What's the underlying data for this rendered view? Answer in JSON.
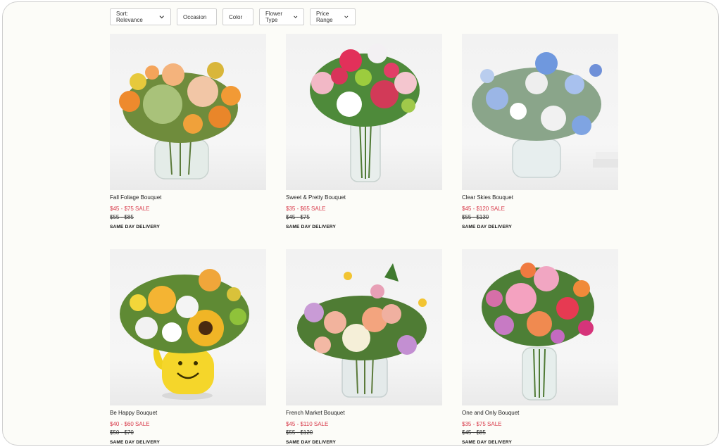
{
  "filters": {
    "sort": "Sort: Relevance",
    "occasion": "Occasion",
    "color": "Color",
    "flower_type": "Flower Type",
    "price_range": "Price Range"
  },
  "products": [
    {
      "name": "Fall Foliage Bouquet",
      "price": "$45 - $75 SALE",
      "original": "$55 - $85",
      "delivery": "SAME DAY DELIVERY"
    },
    {
      "name": "Sweet & Pretty Bouquet",
      "price": "$35 - $65 SALE",
      "original": "$45 - $75",
      "delivery": "SAME DAY DELIVERY"
    },
    {
      "name": "Clear Skies Bouquet",
      "price": "$45 - $120 SALE",
      "original": "$55 - $130",
      "delivery": "SAME DAY DELIVERY"
    },
    {
      "name": "Be Happy Bouquet",
      "price": "$40 - $60 SALE",
      "original": "$50 - $70",
      "delivery": "SAME DAY DELIVERY"
    },
    {
      "name": "French Market Bouquet",
      "price": "$45 - $110 SALE",
      "original": "$55 - $120",
      "delivery": "SAME DAY DELIVERY"
    },
    {
      "name": "One and Only Bouquet",
      "price": "$35 - $75 SALE",
      "original": "$45 - $85",
      "delivery": "SAME DAY DELIVERY"
    }
  ],
  "colors": {
    "sale_price": "#d83a4a",
    "background": "#fcfcf8"
  }
}
